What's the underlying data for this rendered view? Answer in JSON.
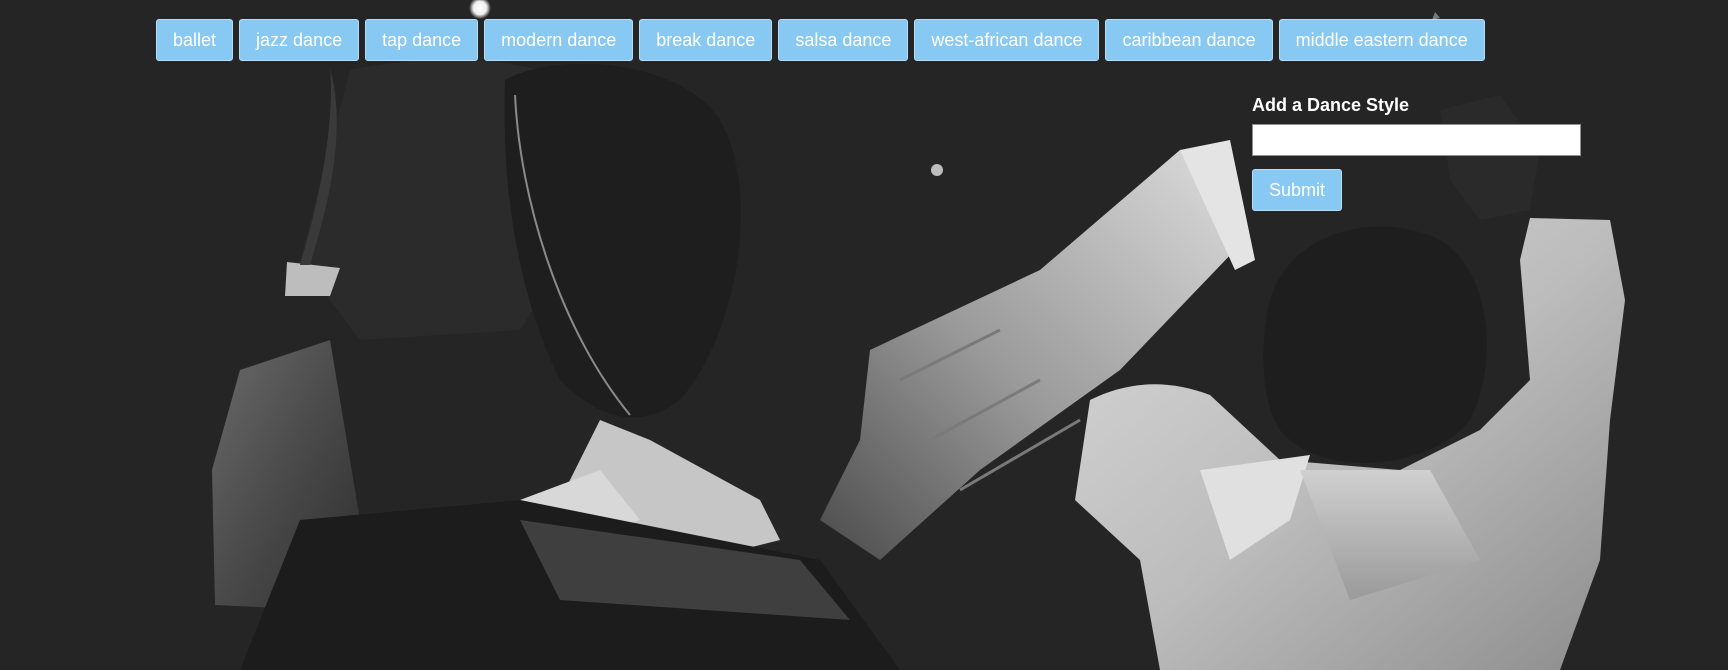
{
  "styles_nav": {
    "items": [
      {
        "label": "ballet"
      },
      {
        "label": "jazz dance"
      },
      {
        "label": "tap dance"
      },
      {
        "label": "modern dance"
      },
      {
        "label": "break dance"
      },
      {
        "label": "salsa dance"
      },
      {
        "label": "west-african dance"
      },
      {
        "label": "caribbean dance"
      },
      {
        "label": "middle eastern dance"
      }
    ]
  },
  "add_form": {
    "label": "Add a Dance Style",
    "input_value": "",
    "submit_label": "Submit"
  },
  "colors": {
    "background": "#252525",
    "button": "#88c9f3",
    "button_text": "#ffffff"
  }
}
